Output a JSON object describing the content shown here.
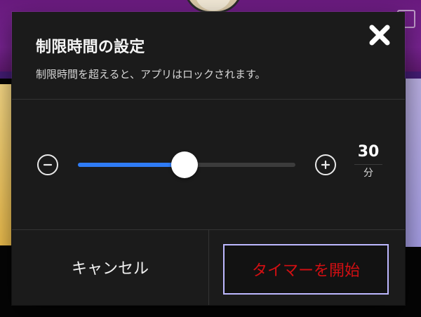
{
  "dialog": {
    "title": "制限時間の設定",
    "description": "制限時間を超えると、アプリはロックされます。",
    "close_icon": "close-icon"
  },
  "timer": {
    "slider_fraction": 0.49,
    "value": "30",
    "unit": "分",
    "minus_icon": "minus-circle-icon",
    "plus_icon": "plus-circle-icon"
  },
  "actions": {
    "cancel_label": "キャンセル",
    "start_label": "タイマーを開始"
  },
  "colors": {
    "dialog_bg": "#1b1b1b",
    "slider_fill": "#2f7cf6",
    "slider_track": "#3c3c3c",
    "start_text": "#d20f12",
    "start_border": "#bdb8ff"
  }
}
